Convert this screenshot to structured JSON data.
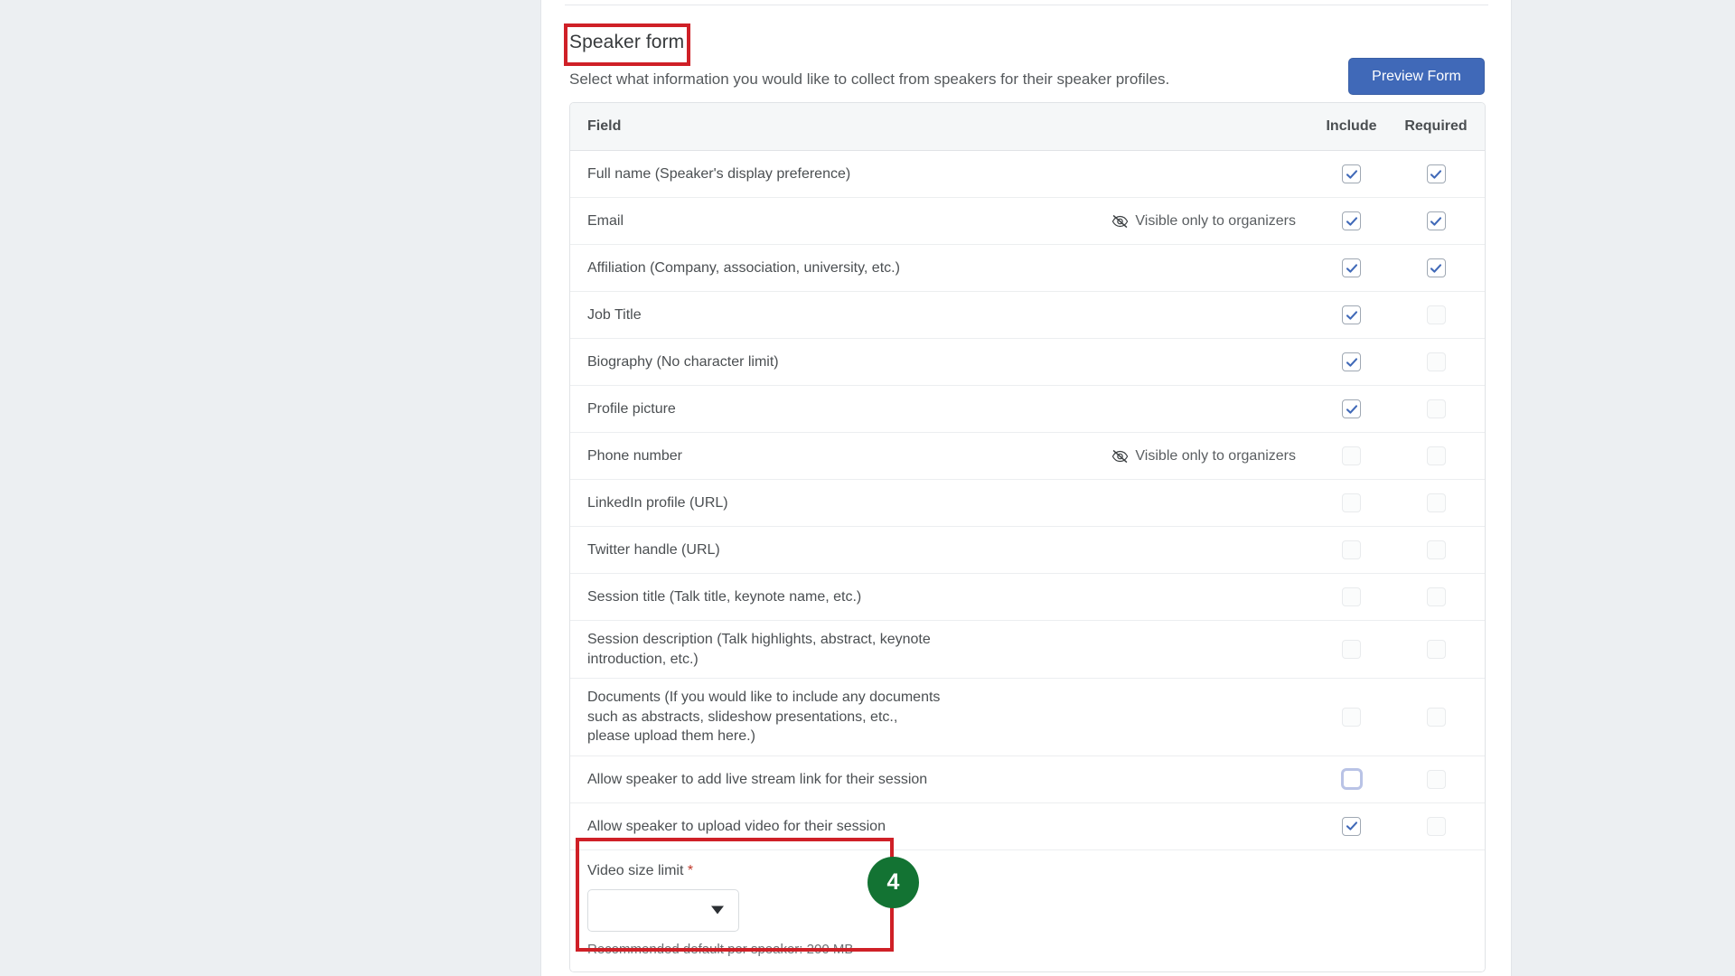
{
  "header": {
    "title": "Speaker form",
    "subtitle": "Select what information you would like to collect from speakers for their speaker profiles.",
    "preview_button": "Preview Form"
  },
  "annotation": {
    "step_number": "4",
    "highlight_color": "#cf2027",
    "badge_color": "#137333"
  },
  "table": {
    "columns": {
      "field": "Field",
      "include": "Include",
      "required": "Required"
    },
    "rows": [
      {
        "label": "Full name (Speaker's display preference)",
        "note": "",
        "include": "checked",
        "required": "checked"
      },
      {
        "label": "Email",
        "note": "Visible only to organizers",
        "include": "checked",
        "required": "checked"
      },
      {
        "label": "Affiliation (Company, association, university, etc.)",
        "note": "",
        "include": "checked",
        "required": "checked"
      },
      {
        "label": "Job Title",
        "note": "",
        "include": "checked",
        "required": "unchecked"
      },
      {
        "label": "Biography (No character limit)",
        "note": "",
        "include": "checked",
        "required": "unchecked"
      },
      {
        "label": "Profile picture",
        "note": "",
        "include": "checked",
        "required": "unchecked"
      },
      {
        "label": "Phone number",
        "note": "Visible only to organizers",
        "include": "unchecked",
        "required": "unchecked"
      },
      {
        "label": "LinkedIn profile (URL)",
        "note": "",
        "include": "unchecked",
        "required": "unchecked"
      },
      {
        "label": "Twitter handle (URL)",
        "note": "",
        "include": "unchecked",
        "required": "unchecked"
      },
      {
        "label": "Session title (Talk title, keynote name, etc.)",
        "note": "",
        "include": "unchecked",
        "required": "unchecked"
      },
      {
        "label": "Session description (Talk highlights, abstract, keynote introduction, etc.)",
        "note": "",
        "include": "unchecked",
        "required": "unchecked"
      },
      {
        "label": "Documents (If you would like to include any documents such as abstracts, slideshow presentations, etc., please upload them here.)",
        "note": "",
        "include": "unchecked",
        "required": "unchecked"
      },
      {
        "label": "Allow speaker to add live stream link for their session",
        "note": "",
        "include": "focused",
        "required": "unchecked"
      },
      {
        "label": "Allow speaker to upload video for their session",
        "note": "",
        "include": "checked",
        "required": "unchecked"
      }
    ]
  },
  "video_size_limit": {
    "label": "Video size limit",
    "required_marker": "*",
    "selected_value": "",
    "help_text": "Recommended default per speaker: 200 MB"
  }
}
